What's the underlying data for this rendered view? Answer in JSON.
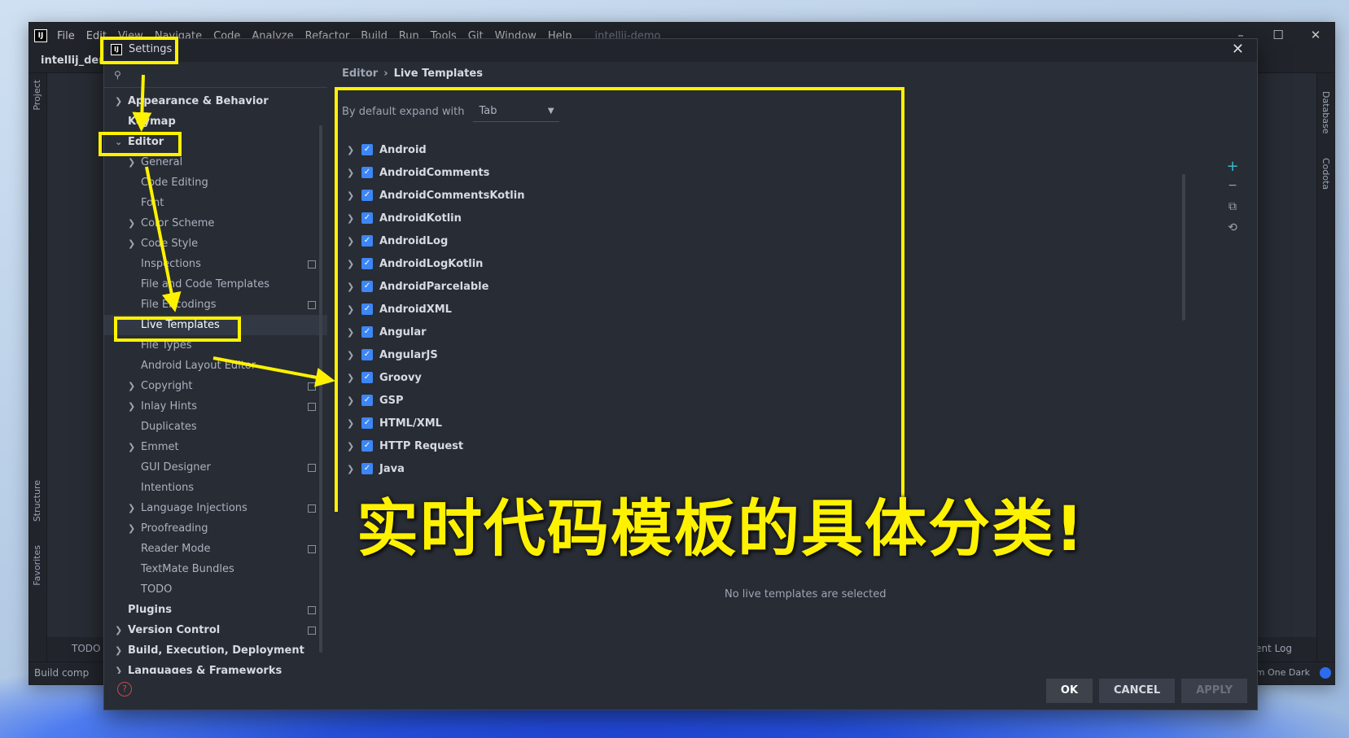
{
  "ide": {
    "menu": [
      "File",
      "Edit",
      "View",
      "Navigate",
      "Code",
      "Analyze",
      "Refactor",
      "Build",
      "Run",
      "Tools",
      "Git",
      "Window",
      "Help"
    ],
    "title": "intellij-demo",
    "project_name": "intellij_dem",
    "left_tabs": [
      "Project",
      "Structure",
      "Favorites"
    ],
    "right_tabs": [
      "Database",
      "Codota"
    ],
    "bottom_todo": "TODO",
    "event_log": "Event Log",
    "status_left": "Build comp",
    "status_theme": "tom One Dark",
    "win_min": "–",
    "win_max": "☐",
    "win_close": "✕"
  },
  "dialog": {
    "title": "Settings",
    "close": "✕",
    "help_icon": "?",
    "buttons": {
      "ok": "OK",
      "cancel": "CANCEL",
      "apply": "APPLY"
    }
  },
  "tree": {
    "items": [
      {
        "label": "Appearance & Behavior"
      },
      {
        "label": "Keymap"
      },
      {
        "label": "Editor"
      },
      {
        "label": "General"
      },
      {
        "label": "Code Editing"
      },
      {
        "label": "Font"
      },
      {
        "label": "Color Scheme"
      },
      {
        "label": "Code Style"
      },
      {
        "label": "Inspections"
      },
      {
        "label": "File and Code Templates"
      },
      {
        "label": "File Encodings"
      },
      {
        "label": "Live Templates"
      },
      {
        "label": "File Types"
      },
      {
        "label": "Android Layout Editor"
      },
      {
        "label": "Copyright"
      },
      {
        "label": "Inlay Hints"
      },
      {
        "label": "Duplicates"
      },
      {
        "label": "Emmet"
      },
      {
        "label": "GUI Designer"
      },
      {
        "label": "Intentions"
      },
      {
        "label": "Language Injections"
      },
      {
        "label": "Proofreading"
      },
      {
        "label": "Reader Mode"
      },
      {
        "label": "TextMate Bundles"
      },
      {
        "label": "TODO"
      },
      {
        "label": "Plugins"
      },
      {
        "label": "Version Control"
      },
      {
        "label": "Build, Execution, Deployment"
      },
      {
        "label": "Languages & Frameworks"
      }
    ]
  },
  "content": {
    "breadcrumb": {
      "parent": "Editor",
      "separator": "›",
      "current": "Live Templates"
    },
    "expand_label": "By default expand with",
    "expand_value": "Tab",
    "groups": [
      {
        "name": "Android",
        "checked": true
      },
      {
        "name": "AndroidComments",
        "checked": true
      },
      {
        "name": "AndroidCommentsKotlin",
        "checked": true
      },
      {
        "name": "AndroidKotlin",
        "checked": true
      },
      {
        "name": "AndroidLog",
        "checked": true
      },
      {
        "name": "AndroidLogKotlin",
        "checked": true
      },
      {
        "name": "AndroidParcelable",
        "checked": true
      },
      {
        "name": "AndroidXML",
        "checked": true
      },
      {
        "name": "Angular",
        "checked": true
      },
      {
        "name": "AngularJS",
        "checked": true
      },
      {
        "name": "Groovy",
        "checked": true
      },
      {
        "name": "GSP",
        "checked": true
      },
      {
        "name": "HTML/XML",
        "checked": true
      },
      {
        "name": "HTTP Request",
        "checked": true
      },
      {
        "name": "Java",
        "checked": true
      }
    ],
    "empty_message": "No live templates are selected"
  },
  "annotation": {
    "caption": "实时代码模板的具体分类!",
    "color": "#fff200"
  }
}
